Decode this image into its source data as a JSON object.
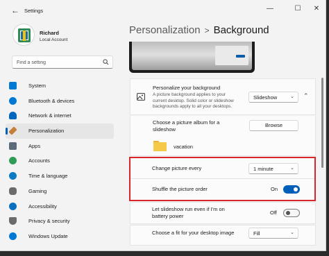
{
  "window": {
    "app_title": "Settings",
    "back_icon": "back-arrow-icon",
    "controls": [
      "minimize-icon",
      "maximize-icon",
      "close-icon"
    ]
  },
  "user": {
    "name": "Richard",
    "account_type": "Local Account"
  },
  "search": {
    "placeholder": "Find a setting"
  },
  "sidebar": {
    "items": [
      {
        "label": "System",
        "icon": "system-icon",
        "color": "#0078d4",
        "active": false
      },
      {
        "label": "Bluetooth & devices",
        "icon": "bluetooth-icon",
        "color": "#0078d4",
        "active": false
      },
      {
        "label": "Network & internet",
        "icon": "network-icon",
        "color": "#0067c0",
        "active": false
      },
      {
        "label": "Personalization",
        "icon": "brush-icon",
        "color": "#c47f3b",
        "active": true
      },
      {
        "label": "Apps",
        "icon": "apps-icon",
        "color": "#5c6b7a",
        "active": false
      },
      {
        "label": "Accounts",
        "icon": "accounts-icon",
        "color": "#2e9c55",
        "active": false
      },
      {
        "label": "Time & language",
        "icon": "globe-clock-icon",
        "color": "#0b7bc2",
        "active": false
      },
      {
        "label": "Gaming",
        "icon": "gaming-icon",
        "color": "#6b6b6b",
        "active": false
      },
      {
        "label": "Accessibility",
        "icon": "accessibility-icon",
        "color": "#0b6fbf",
        "active": false
      },
      {
        "label": "Privacy & security",
        "icon": "shield-icon",
        "color": "#6b6b6b",
        "active": false
      },
      {
        "label": "Windows Update",
        "icon": "update-icon",
        "color": "#0078d4",
        "active": false
      }
    ]
  },
  "header": {
    "parent": "Personalization",
    "separator": ">",
    "current": "Background"
  },
  "settings": {
    "personalize": {
      "title": "Personalize your background",
      "description_lines": [
        "A picture background applies to your",
        "current desktop. Solid color or slideshow",
        "backgrounds apply to all your desktops."
      ],
      "value": "Slideshow",
      "icon": "picture-icon",
      "collapse_icon": "chevron-up-icon"
    },
    "album": {
      "title_lines": [
        "Choose a picture album for a",
        "slideshow"
      ],
      "button": "Browse",
      "folder_name": "vacation",
      "folder_icon": "folder-icon"
    },
    "interval": {
      "label": "Change picture every",
      "value": "1 minute"
    },
    "shuffle": {
      "label": "Shuffle the picture order",
      "state_label": "On",
      "on": true
    },
    "battery": {
      "label_lines": [
        "Let slideshow run even if I'm on",
        "battery power"
      ],
      "state_label": "Off",
      "on": false
    },
    "fit": {
      "label": "Choose a fit for your desktop image",
      "value": "Fill"
    }
  },
  "colors": {
    "accent": "#005fb8",
    "highlight_border": "#d9262a"
  }
}
